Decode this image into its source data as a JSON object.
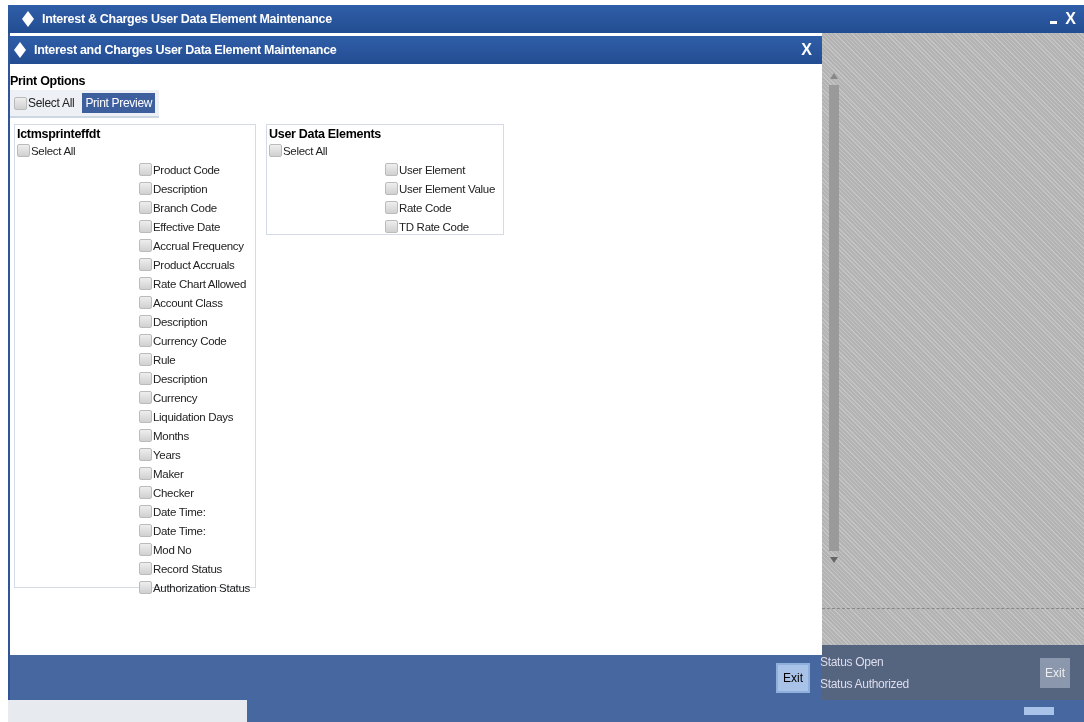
{
  "window": {
    "title": "Interest & Charges User Data Element Maintenance",
    "close": "X"
  },
  "dialog": {
    "title": "Interest and Charges User Data Element Maintenance",
    "close": "X",
    "print_options": {
      "label": "Print Options",
      "select_all": {
        "label": "Select All",
        "checked": false
      },
      "button": "Print Preview"
    },
    "groups": [
      {
        "legend": "Ictmsprinteffdt",
        "select_all": {
          "label": "Select All",
          "checked": false
        },
        "items": [
          {
            "label": "Product Code",
            "checked": false
          },
          {
            "label": "Description",
            "checked": false
          },
          {
            "label": "Branch Code",
            "checked": false
          },
          {
            "label": "Effective Date",
            "checked": false
          },
          {
            "label": "Accrual Frequency",
            "checked": false
          },
          {
            "label": "Product Accruals",
            "checked": false
          },
          {
            "label": "Rate Chart Allowed",
            "checked": false
          },
          {
            "label": "Account Class",
            "checked": false
          },
          {
            "label": "Description",
            "checked": false
          },
          {
            "label": "Currency Code",
            "checked": false
          },
          {
            "label": "Rule",
            "checked": false
          },
          {
            "label": "Description",
            "checked": false
          },
          {
            "label": "Currency",
            "checked": false
          },
          {
            "label": "Liquidation Days",
            "checked": false
          },
          {
            "label": "Months",
            "checked": false
          },
          {
            "label": "Years",
            "checked": false
          },
          {
            "label": "Maker",
            "checked": false
          },
          {
            "label": "Checker",
            "checked": false
          },
          {
            "label": "Date Time:",
            "checked": false
          },
          {
            "label": "Date Time:",
            "checked": false
          },
          {
            "label": "Mod No",
            "checked": false
          },
          {
            "label": "Record Status",
            "checked": false
          },
          {
            "label": "Authorization Status",
            "checked": false
          }
        ]
      },
      {
        "legend": "User Data Elements",
        "select_all": {
          "label": "Select All",
          "checked": false
        },
        "items": [
          {
            "label": "User Element",
            "checked": false
          },
          {
            "label": "User Element Value",
            "checked": false
          },
          {
            "label": "Rate Code",
            "checked": false
          },
          {
            "label": "TD Rate Code",
            "checked": false
          }
        ]
      }
    ],
    "footer_button": "Exit"
  },
  "background_panel": {
    "status": [
      "Status Open",
      "Status Authorized"
    ],
    "button": "Exit"
  }
}
